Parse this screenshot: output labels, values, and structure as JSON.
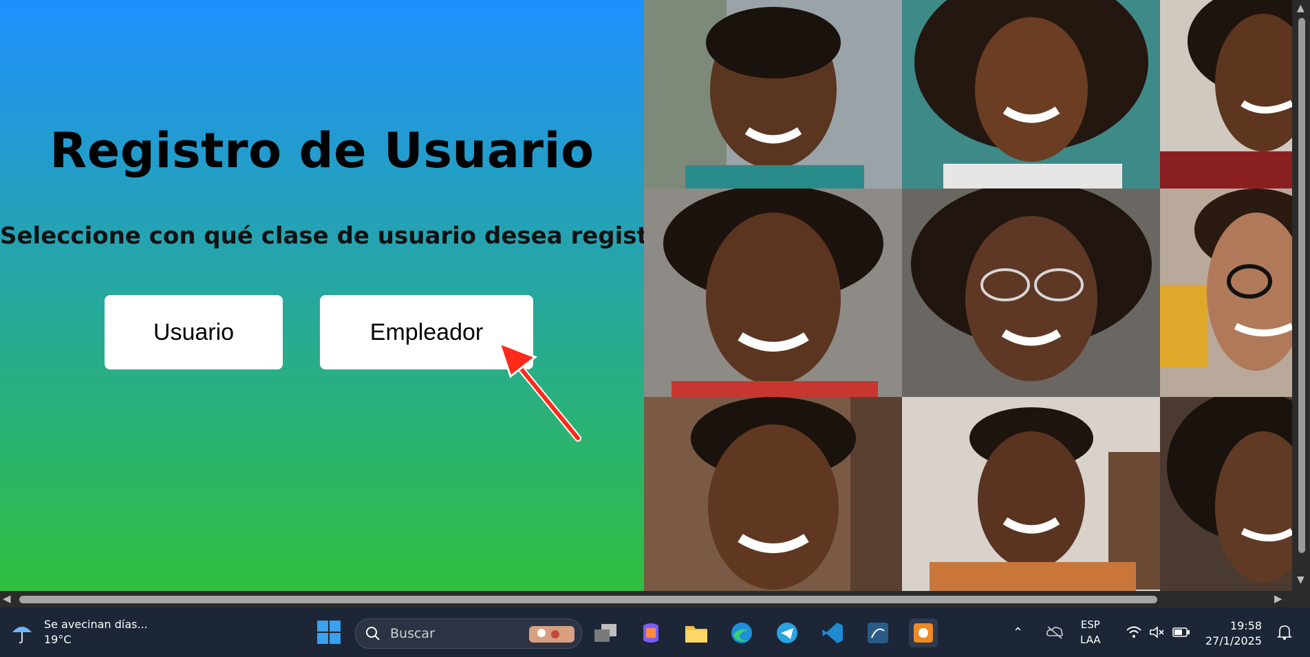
{
  "page": {
    "title": "Registro de Usuario",
    "subtitle": "Seleccione con qué clase de usuario desea registrarse",
    "buttons": {
      "usuario": "Usuario",
      "empleador": "Empleador"
    }
  },
  "photo_grid": {
    "tiles": 9,
    "description_icons": [
      "person-photo"
    ]
  },
  "taskbar": {
    "weather_text": "Se avecinan días...",
    "weather_temp": "19°C",
    "search_label": "Buscar",
    "apps": [
      "task-view",
      "copilot",
      "file-explorer",
      "edge",
      "telegram",
      "vscode",
      "mysql-workbench",
      "screenshot-tool"
    ],
    "language_top": "ESP",
    "language_bottom": "LAA",
    "time": "19:58",
    "date": "27/1/2025"
  },
  "colors": {
    "gradient_top": "#1e90ff",
    "gradient_bottom": "#2fbf3f",
    "arrow": "#ff2a1a",
    "taskbar": "#1c2636"
  }
}
